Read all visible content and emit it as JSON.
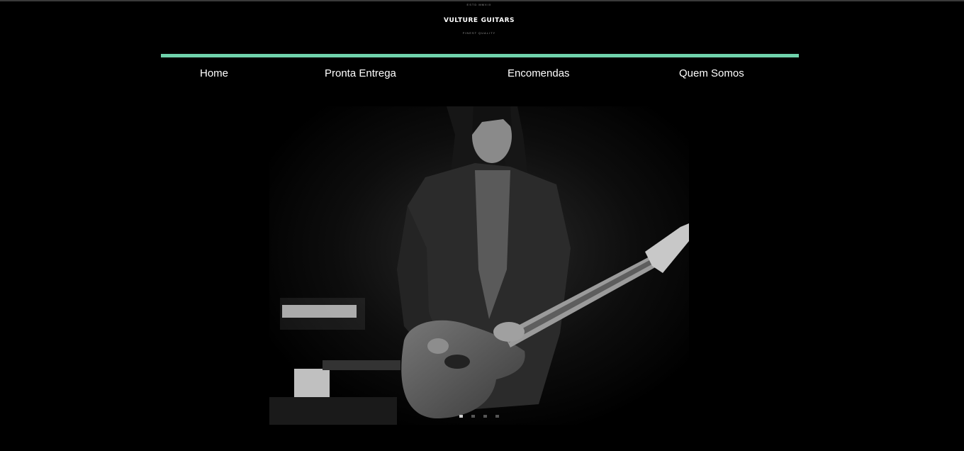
{
  "logo": {
    "top_text": "ESTD MMXIX",
    "brand_left": "VULTURE",
    "brand_right": "GUITARS",
    "bottom_text": "FINEST QUALITY"
  },
  "colors": {
    "accent": "#6fd2ab",
    "background": "#000000",
    "nav_text": "#ffffff"
  },
  "nav": {
    "items": [
      {
        "label": "Home"
      },
      {
        "label": "Pronta Entrega"
      },
      {
        "label": "Encomendas"
      },
      {
        "label": "Quem Somos"
      }
    ]
  },
  "carousel": {
    "slide_count": 4,
    "active_index": 0
  }
}
